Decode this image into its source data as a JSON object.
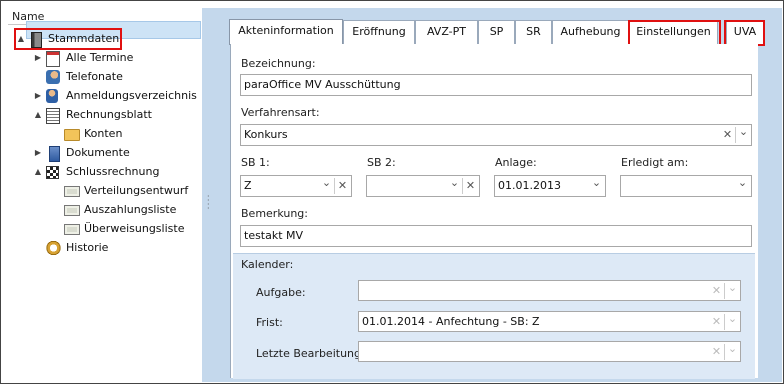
{
  "tree": {
    "header": "Name",
    "items": [
      {
        "label": "Stammdaten",
        "icon": "binder-icon",
        "expander": "▲"
      },
      {
        "label": "Alle Termine",
        "icon": "calendar-icon",
        "expander": "▶"
      },
      {
        "label": "Telefonate",
        "icon": "phone-person-icon",
        "expander": ""
      },
      {
        "label": "Anmeldungsverzeichnis",
        "icon": "person-folder-icon",
        "expander": "▶"
      },
      {
        "label": "Rechnungsblatt",
        "icon": "ledger-icon",
        "expander": "▲"
      },
      {
        "label": "Konten",
        "icon": "folder-icon",
        "expander": ""
      },
      {
        "label": "Dokumente",
        "icon": "documents-icon",
        "expander": "▶"
      },
      {
        "label": "Schlussrechnung",
        "icon": "checkered-icon",
        "expander": "▲"
      },
      {
        "label": "Verteilungsentwurf",
        "icon": "money-icon",
        "expander": ""
      },
      {
        "label": "Auszahlungsliste",
        "icon": "money-icon",
        "expander": ""
      },
      {
        "label": "Überweisungsliste",
        "icon": "money-icon",
        "expander": ""
      },
      {
        "label": "Historie",
        "icon": "history-icon",
        "expander": ""
      }
    ]
  },
  "tabs": [
    "Akteninformation",
    "Eröffnung",
    "AVZ-PT",
    "SP",
    "SR",
    "Aufhebung",
    "Einstellungen",
    "UVA"
  ],
  "form": {
    "bezeichnung_label": "Bezeichnung:",
    "bezeichnung_value": "paraOffice MV Ausschüttung",
    "verfahrensart_label": "Verfahrensart:",
    "verfahrensart_value": "Konkurs",
    "sb1_label": "SB 1:",
    "sb1_value": "Z",
    "sb2_label": "SB 2:",
    "sb2_value": "",
    "anlage_label": "Anlage:",
    "anlage_value": "01.01.2013",
    "erledigt_label": "Erledigt am:",
    "erledigt_value": "",
    "bemerkung_label": "Bemerkung:",
    "bemerkung_value": "testakt MV"
  },
  "kalender": {
    "title": "Kalender:",
    "aufgabe_label": "Aufgabe:",
    "aufgabe_value": "",
    "frist_label": "Frist:",
    "frist_value": "01.01.2014 - Anfechtung - SB: Z",
    "letzte_label": "Letzte Bearbeitung:",
    "letzte_value": ""
  },
  "glyphs": {
    "clear": "✕",
    "dropdown": "⌄"
  },
  "colors": {
    "highlight": "#e01010",
    "selection": "#cde3f6",
    "panel_bg": "#c4d8ec",
    "kalender_bg": "#dde9f6"
  }
}
